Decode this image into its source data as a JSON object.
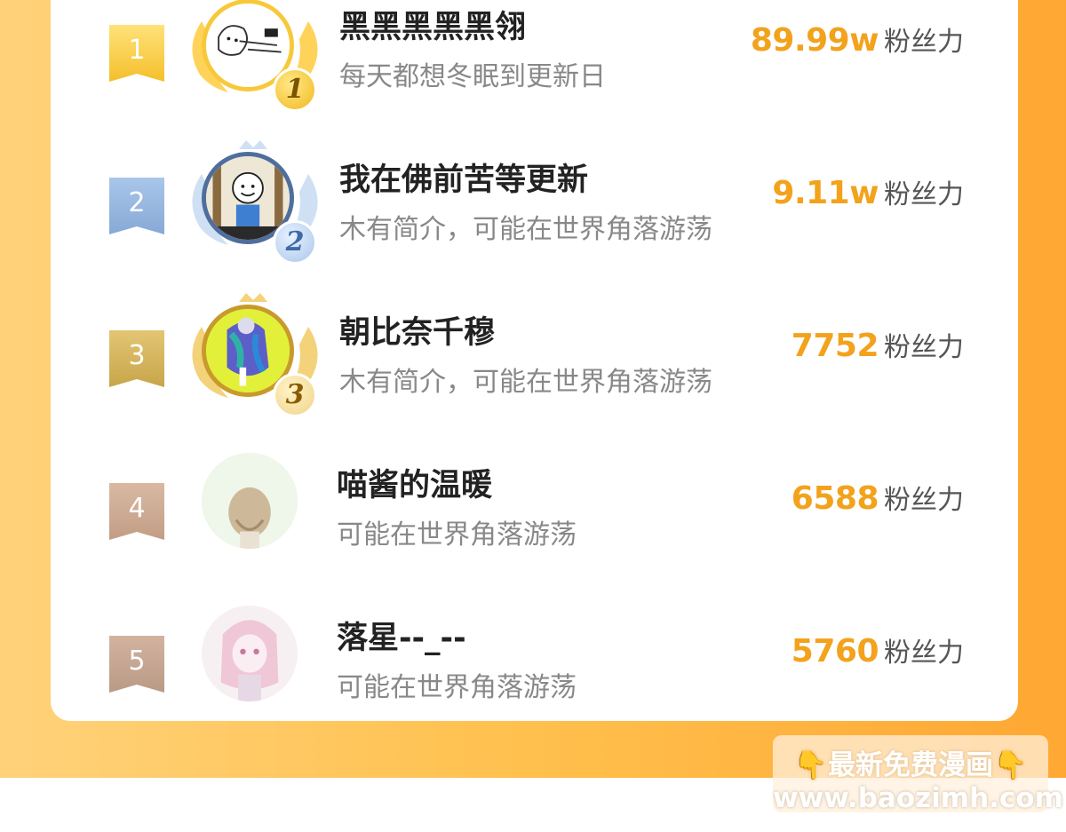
{
  "unit_label": "粉丝力",
  "rows": [
    {
      "rank": "1",
      "badge": "1",
      "name": "黑黑黑黑黑翎",
      "desc": "每天都想冬眠到更新日",
      "score": "89.99w"
    },
    {
      "rank": "2",
      "badge": "2",
      "name": "我在佛前苦等更新",
      "desc": "木有简介，可能在世界角落游荡",
      "score": "9.11w"
    },
    {
      "rank": "3",
      "badge": "3",
      "name": "朝比奈千穆",
      "desc": "木有简介，可能在世界角落游荡",
      "score": "7752"
    },
    {
      "rank": "4",
      "name": "喵酱的温暖",
      "desc": "可能在世界角落游荡",
      "score": "6588"
    },
    {
      "rank": "5",
      "name": "落星--_--",
      "desc": "可能在世界角落游荡",
      "score": "5760"
    }
  ],
  "watermark": {
    "line1": "最新免费漫画",
    "line2": "www.baozimh.com",
    "icon": "pointing-down-hand-icon"
  },
  "colors": {
    "rank1": "#f7c93a",
    "rank2": "#8fb3dd",
    "rank3": "#d2b25a",
    "rank4": "#c9a68f",
    "rank5": "#bf9f89",
    "score": "#f3a21c",
    "bg_start": "#ffd27a",
    "bg_end": "#ffa733"
  }
}
